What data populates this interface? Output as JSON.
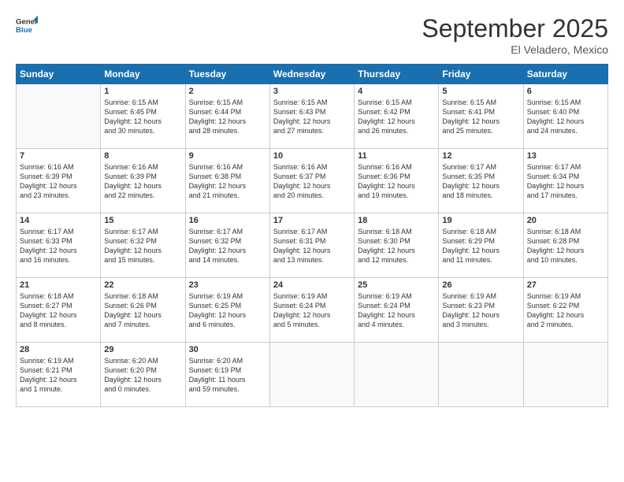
{
  "logo": {
    "general": "General",
    "blue": "Blue"
  },
  "header": {
    "month": "September 2025",
    "location": "El Veladero, Mexico"
  },
  "weekdays": [
    "Sunday",
    "Monday",
    "Tuesday",
    "Wednesday",
    "Thursday",
    "Friday",
    "Saturday"
  ],
  "weeks": [
    [
      {
        "day": "",
        "lines": []
      },
      {
        "day": "1",
        "lines": [
          "Sunrise: 6:15 AM",
          "Sunset: 6:45 PM",
          "Daylight: 12 hours",
          "and 30 minutes."
        ]
      },
      {
        "day": "2",
        "lines": [
          "Sunrise: 6:15 AM",
          "Sunset: 6:44 PM",
          "Daylight: 12 hours",
          "and 28 minutes."
        ]
      },
      {
        "day": "3",
        "lines": [
          "Sunrise: 6:15 AM",
          "Sunset: 6:43 PM",
          "Daylight: 12 hours",
          "and 27 minutes."
        ]
      },
      {
        "day": "4",
        "lines": [
          "Sunrise: 6:15 AM",
          "Sunset: 6:42 PM",
          "Daylight: 12 hours",
          "and 26 minutes."
        ]
      },
      {
        "day": "5",
        "lines": [
          "Sunrise: 6:15 AM",
          "Sunset: 6:41 PM",
          "Daylight: 12 hours",
          "and 25 minutes."
        ]
      },
      {
        "day": "6",
        "lines": [
          "Sunrise: 6:15 AM",
          "Sunset: 6:40 PM",
          "Daylight: 12 hours",
          "and 24 minutes."
        ]
      }
    ],
    [
      {
        "day": "7",
        "lines": [
          "Sunrise: 6:16 AM",
          "Sunset: 6:39 PM",
          "Daylight: 12 hours",
          "and 23 minutes."
        ]
      },
      {
        "day": "8",
        "lines": [
          "Sunrise: 6:16 AM",
          "Sunset: 6:39 PM",
          "Daylight: 12 hours",
          "and 22 minutes."
        ]
      },
      {
        "day": "9",
        "lines": [
          "Sunrise: 6:16 AM",
          "Sunset: 6:38 PM",
          "Daylight: 12 hours",
          "and 21 minutes."
        ]
      },
      {
        "day": "10",
        "lines": [
          "Sunrise: 6:16 AM",
          "Sunset: 6:37 PM",
          "Daylight: 12 hours",
          "and 20 minutes."
        ]
      },
      {
        "day": "11",
        "lines": [
          "Sunrise: 6:16 AM",
          "Sunset: 6:36 PM",
          "Daylight: 12 hours",
          "and 19 minutes."
        ]
      },
      {
        "day": "12",
        "lines": [
          "Sunrise: 6:17 AM",
          "Sunset: 6:35 PM",
          "Daylight: 12 hours",
          "and 18 minutes."
        ]
      },
      {
        "day": "13",
        "lines": [
          "Sunrise: 6:17 AM",
          "Sunset: 6:34 PM",
          "Daylight: 12 hours",
          "and 17 minutes."
        ]
      }
    ],
    [
      {
        "day": "14",
        "lines": [
          "Sunrise: 6:17 AM",
          "Sunset: 6:33 PM",
          "Daylight: 12 hours",
          "and 16 minutes."
        ]
      },
      {
        "day": "15",
        "lines": [
          "Sunrise: 6:17 AM",
          "Sunset: 6:32 PM",
          "Daylight: 12 hours",
          "and 15 minutes."
        ]
      },
      {
        "day": "16",
        "lines": [
          "Sunrise: 6:17 AM",
          "Sunset: 6:32 PM",
          "Daylight: 12 hours",
          "and 14 minutes."
        ]
      },
      {
        "day": "17",
        "lines": [
          "Sunrise: 6:17 AM",
          "Sunset: 6:31 PM",
          "Daylight: 12 hours",
          "and 13 minutes."
        ]
      },
      {
        "day": "18",
        "lines": [
          "Sunrise: 6:18 AM",
          "Sunset: 6:30 PM",
          "Daylight: 12 hours",
          "and 12 minutes."
        ]
      },
      {
        "day": "19",
        "lines": [
          "Sunrise: 6:18 AM",
          "Sunset: 6:29 PM",
          "Daylight: 12 hours",
          "and 11 minutes."
        ]
      },
      {
        "day": "20",
        "lines": [
          "Sunrise: 6:18 AM",
          "Sunset: 6:28 PM",
          "Daylight: 12 hours",
          "and 10 minutes."
        ]
      }
    ],
    [
      {
        "day": "21",
        "lines": [
          "Sunrise: 6:18 AM",
          "Sunset: 6:27 PM",
          "Daylight: 12 hours",
          "and 8 minutes."
        ]
      },
      {
        "day": "22",
        "lines": [
          "Sunrise: 6:18 AM",
          "Sunset: 6:26 PM",
          "Daylight: 12 hours",
          "and 7 minutes."
        ]
      },
      {
        "day": "23",
        "lines": [
          "Sunrise: 6:19 AM",
          "Sunset: 6:25 PM",
          "Daylight: 12 hours",
          "and 6 minutes."
        ]
      },
      {
        "day": "24",
        "lines": [
          "Sunrise: 6:19 AM",
          "Sunset: 6:24 PM",
          "Daylight: 12 hours",
          "and 5 minutes."
        ]
      },
      {
        "day": "25",
        "lines": [
          "Sunrise: 6:19 AM",
          "Sunset: 6:24 PM",
          "Daylight: 12 hours",
          "and 4 minutes."
        ]
      },
      {
        "day": "26",
        "lines": [
          "Sunrise: 6:19 AM",
          "Sunset: 6:23 PM",
          "Daylight: 12 hours",
          "and 3 minutes."
        ]
      },
      {
        "day": "27",
        "lines": [
          "Sunrise: 6:19 AM",
          "Sunset: 6:22 PM",
          "Daylight: 12 hours",
          "and 2 minutes."
        ]
      }
    ],
    [
      {
        "day": "28",
        "lines": [
          "Sunrise: 6:19 AM",
          "Sunset: 6:21 PM",
          "Daylight: 12 hours",
          "and 1 minute."
        ]
      },
      {
        "day": "29",
        "lines": [
          "Sunrise: 6:20 AM",
          "Sunset: 6:20 PM",
          "Daylight: 12 hours",
          "and 0 minutes."
        ]
      },
      {
        "day": "30",
        "lines": [
          "Sunrise: 6:20 AM",
          "Sunset: 6:19 PM",
          "Daylight: 11 hours",
          "and 59 minutes."
        ]
      },
      {
        "day": "",
        "lines": []
      },
      {
        "day": "",
        "lines": []
      },
      {
        "day": "",
        "lines": []
      },
      {
        "day": "",
        "lines": []
      }
    ]
  ]
}
